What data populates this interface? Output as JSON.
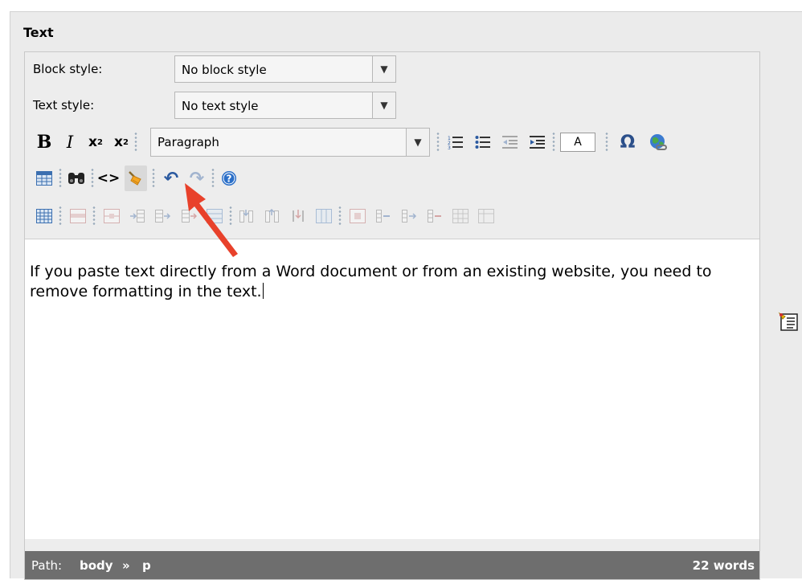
{
  "field": {
    "title": "Text"
  },
  "block_style": {
    "label": "Block style:",
    "value": "No block style"
  },
  "text_style": {
    "label": "Text style:",
    "value": "No text style"
  },
  "format_select": {
    "value": "Paragraph"
  },
  "font_color_button": {
    "label": "A"
  },
  "editor_content": "If you paste text directly from a Word document or from an existing website, you need to remove formatting in the text.",
  "status_bar": {
    "path_label": "Path:",
    "path": [
      "body",
      "p"
    ],
    "separator": "»",
    "word_count": "22 words"
  },
  "icons": {
    "row1": [
      "bold",
      "italic",
      "subscript",
      "superscript",
      "format-dropdown",
      "ordered-list",
      "unordered-list",
      "outdent",
      "indent",
      "font-color",
      "special-character",
      "insert-link-globe"
    ],
    "row2": [
      "table",
      "find-replace",
      "html-source",
      "cleanup-formatting-broom",
      "undo",
      "redo",
      "help"
    ],
    "row3": [
      "table-properties",
      "row-properties",
      "cell-properties",
      "insert-row-before",
      "insert-row-after",
      "delete-row",
      "insert-col-before",
      "insert-col-after",
      "delete-col",
      "split-cells",
      "merge-cells"
    ]
  },
  "annotation": {
    "arrow_color": "#e8412b",
    "target": "cleanup-formatting-broom"
  }
}
